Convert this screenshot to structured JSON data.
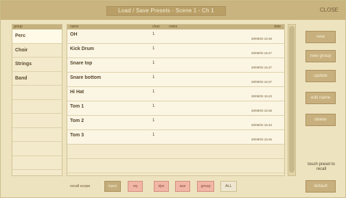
{
  "window": {
    "title": "Load / Save Presets - Scene 1 - Ch 1",
    "close_label": "CLOSE"
  },
  "groups": {
    "header": "group",
    "items": [
      "Perc",
      "Choir",
      "Strings",
      "Band"
    ]
  },
  "presets": {
    "headers": {
      "name": "name",
      "num": "chan",
      "notes": "notes",
      "date": "date"
    },
    "rows": [
      {
        "name": "OH",
        "num": "1",
        "date": "30/09/03 15:48"
      },
      {
        "name": "Kick Drum",
        "num": "1",
        "date": "30/09/03 15:47"
      },
      {
        "name": "Snare top",
        "num": "1",
        "date": "30/09/03 15:47"
      },
      {
        "name": "Snare bottom",
        "num": "1",
        "date": "30/09/03 15:37"
      },
      {
        "name": "Hi Hat",
        "num": "1",
        "date": "30/09/03 15:43"
      },
      {
        "name": "Tom 1",
        "num": "1",
        "date": "30/09/03 15:38"
      },
      {
        "name": "Tom 2",
        "num": "1",
        "date": "30/09/03 15:43"
      },
      {
        "name": "Tom 3",
        "num": "1",
        "date": "30/09/03 15:45"
      }
    ]
  },
  "side_buttons": {
    "new": "new",
    "new_group": "new group",
    "update": "update",
    "edit_name": "edit name",
    "delete": "delete",
    "touch_label": "touch preset to recall",
    "default": "default"
  },
  "recall_scope": {
    "label": "recall scope",
    "buttons": [
      "input",
      "eq",
      "dyn",
      "aux",
      "group",
      "ALL"
    ]
  }
}
